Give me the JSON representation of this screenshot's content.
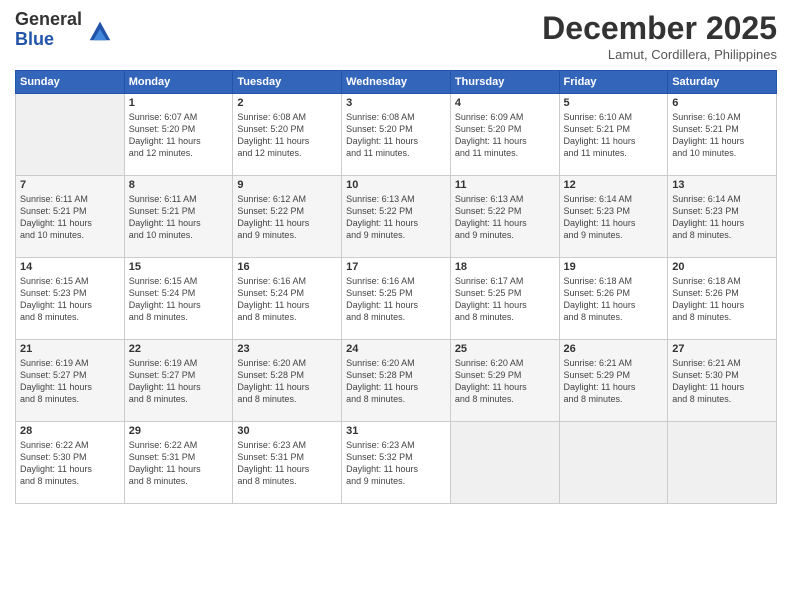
{
  "header": {
    "logo_line1": "General",
    "logo_line2": "Blue",
    "month": "December 2025",
    "location": "Lamut, Cordillera, Philippines"
  },
  "weekdays": [
    "Sunday",
    "Monday",
    "Tuesday",
    "Wednesday",
    "Thursday",
    "Friday",
    "Saturday"
  ],
  "weeks": [
    [
      {
        "day": "",
        "info": ""
      },
      {
        "day": "1",
        "info": "Sunrise: 6:07 AM\nSunset: 5:20 PM\nDaylight: 11 hours\nand 12 minutes."
      },
      {
        "day": "2",
        "info": "Sunrise: 6:08 AM\nSunset: 5:20 PM\nDaylight: 11 hours\nand 12 minutes."
      },
      {
        "day": "3",
        "info": "Sunrise: 6:08 AM\nSunset: 5:20 PM\nDaylight: 11 hours\nand 11 minutes."
      },
      {
        "day": "4",
        "info": "Sunrise: 6:09 AM\nSunset: 5:20 PM\nDaylight: 11 hours\nand 11 minutes."
      },
      {
        "day": "5",
        "info": "Sunrise: 6:10 AM\nSunset: 5:21 PM\nDaylight: 11 hours\nand 11 minutes."
      },
      {
        "day": "6",
        "info": "Sunrise: 6:10 AM\nSunset: 5:21 PM\nDaylight: 11 hours\nand 10 minutes."
      }
    ],
    [
      {
        "day": "7",
        "info": "Sunrise: 6:11 AM\nSunset: 5:21 PM\nDaylight: 11 hours\nand 10 minutes."
      },
      {
        "day": "8",
        "info": "Sunrise: 6:11 AM\nSunset: 5:21 PM\nDaylight: 11 hours\nand 10 minutes."
      },
      {
        "day": "9",
        "info": "Sunrise: 6:12 AM\nSunset: 5:22 PM\nDaylight: 11 hours\nand 9 minutes."
      },
      {
        "day": "10",
        "info": "Sunrise: 6:13 AM\nSunset: 5:22 PM\nDaylight: 11 hours\nand 9 minutes."
      },
      {
        "day": "11",
        "info": "Sunrise: 6:13 AM\nSunset: 5:22 PM\nDaylight: 11 hours\nand 9 minutes."
      },
      {
        "day": "12",
        "info": "Sunrise: 6:14 AM\nSunset: 5:23 PM\nDaylight: 11 hours\nand 9 minutes."
      },
      {
        "day": "13",
        "info": "Sunrise: 6:14 AM\nSunset: 5:23 PM\nDaylight: 11 hours\nand 8 minutes."
      }
    ],
    [
      {
        "day": "14",
        "info": "Sunrise: 6:15 AM\nSunset: 5:23 PM\nDaylight: 11 hours\nand 8 minutes."
      },
      {
        "day": "15",
        "info": "Sunrise: 6:15 AM\nSunset: 5:24 PM\nDaylight: 11 hours\nand 8 minutes."
      },
      {
        "day": "16",
        "info": "Sunrise: 6:16 AM\nSunset: 5:24 PM\nDaylight: 11 hours\nand 8 minutes."
      },
      {
        "day": "17",
        "info": "Sunrise: 6:16 AM\nSunset: 5:25 PM\nDaylight: 11 hours\nand 8 minutes."
      },
      {
        "day": "18",
        "info": "Sunrise: 6:17 AM\nSunset: 5:25 PM\nDaylight: 11 hours\nand 8 minutes."
      },
      {
        "day": "19",
        "info": "Sunrise: 6:18 AM\nSunset: 5:26 PM\nDaylight: 11 hours\nand 8 minutes."
      },
      {
        "day": "20",
        "info": "Sunrise: 6:18 AM\nSunset: 5:26 PM\nDaylight: 11 hours\nand 8 minutes."
      }
    ],
    [
      {
        "day": "21",
        "info": "Sunrise: 6:19 AM\nSunset: 5:27 PM\nDaylight: 11 hours\nand 8 minutes."
      },
      {
        "day": "22",
        "info": "Sunrise: 6:19 AM\nSunset: 5:27 PM\nDaylight: 11 hours\nand 8 minutes."
      },
      {
        "day": "23",
        "info": "Sunrise: 6:20 AM\nSunset: 5:28 PM\nDaylight: 11 hours\nand 8 minutes."
      },
      {
        "day": "24",
        "info": "Sunrise: 6:20 AM\nSunset: 5:28 PM\nDaylight: 11 hours\nand 8 minutes."
      },
      {
        "day": "25",
        "info": "Sunrise: 6:20 AM\nSunset: 5:29 PM\nDaylight: 11 hours\nand 8 minutes."
      },
      {
        "day": "26",
        "info": "Sunrise: 6:21 AM\nSunset: 5:29 PM\nDaylight: 11 hours\nand 8 minutes."
      },
      {
        "day": "27",
        "info": "Sunrise: 6:21 AM\nSunset: 5:30 PM\nDaylight: 11 hours\nand 8 minutes."
      }
    ],
    [
      {
        "day": "28",
        "info": "Sunrise: 6:22 AM\nSunset: 5:30 PM\nDaylight: 11 hours\nand 8 minutes."
      },
      {
        "day": "29",
        "info": "Sunrise: 6:22 AM\nSunset: 5:31 PM\nDaylight: 11 hours\nand 8 minutes."
      },
      {
        "day": "30",
        "info": "Sunrise: 6:23 AM\nSunset: 5:31 PM\nDaylight: 11 hours\nand 8 minutes."
      },
      {
        "day": "31",
        "info": "Sunrise: 6:23 AM\nSunset: 5:32 PM\nDaylight: 11 hours\nand 9 minutes."
      },
      {
        "day": "",
        "info": ""
      },
      {
        "day": "",
        "info": ""
      },
      {
        "day": "",
        "info": ""
      }
    ]
  ]
}
